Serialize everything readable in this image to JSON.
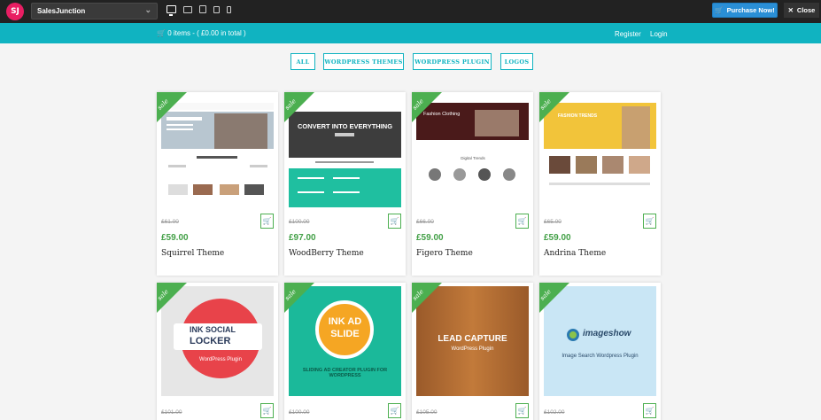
{
  "topbar": {
    "logo_text": "SJ",
    "theme_select": "SalesJunction",
    "purchase_label": "Purchase Now!",
    "close_label": "Close"
  },
  "storebar": {
    "cart_summary": "0 items - ( £0.00 in total )",
    "register": "Register",
    "login": "Login"
  },
  "filters": [
    "ALL",
    "WORDPRESS THEMES",
    "WORDPRESS PLUGIN",
    "LOGOS"
  ],
  "sale_label": "sale",
  "products": [
    {
      "name": "Squirrel Theme",
      "old_price": "£61.00",
      "price": "£59.00"
    },
    {
      "name": "WoodBerry Theme",
      "old_price": "£100.00",
      "price": "£97.00",
      "hero": "CONVERT INTO EVERYTHING"
    },
    {
      "name": "Figero Theme",
      "old_price": "£66.00",
      "price": "£59.00",
      "hero": "Fashion Clothing",
      "section": "Digital Trends"
    },
    {
      "name": "Andrina Theme",
      "old_price": "£65.00",
      "price": "£59.00",
      "hero": "FASHION TRENDS"
    },
    {
      "old_price": "£101.00",
      "line1": "INK SOCIAL",
      "line2": "LOCKER",
      "sub": "WordPress Plugin"
    },
    {
      "old_price": "£100.00",
      "line1": "INK AD",
      "line2": "SLIDE",
      "sub": "SLIDING AD CREATOR PLUGIN FOR WORDPRESS"
    },
    {
      "old_price": "£105.00",
      "line1": "LEAD CAPTURE",
      "sub": "WordPress Plugin"
    },
    {
      "old_price": "£102.00",
      "line1": "imageshow",
      "sub": "Image Search Wordpress Plugin"
    }
  ],
  "colors": {
    "accent": "#10b3c1",
    "sale": "#4caf50",
    "price": "#43a047",
    "purchase": "#2a8fd6"
  }
}
